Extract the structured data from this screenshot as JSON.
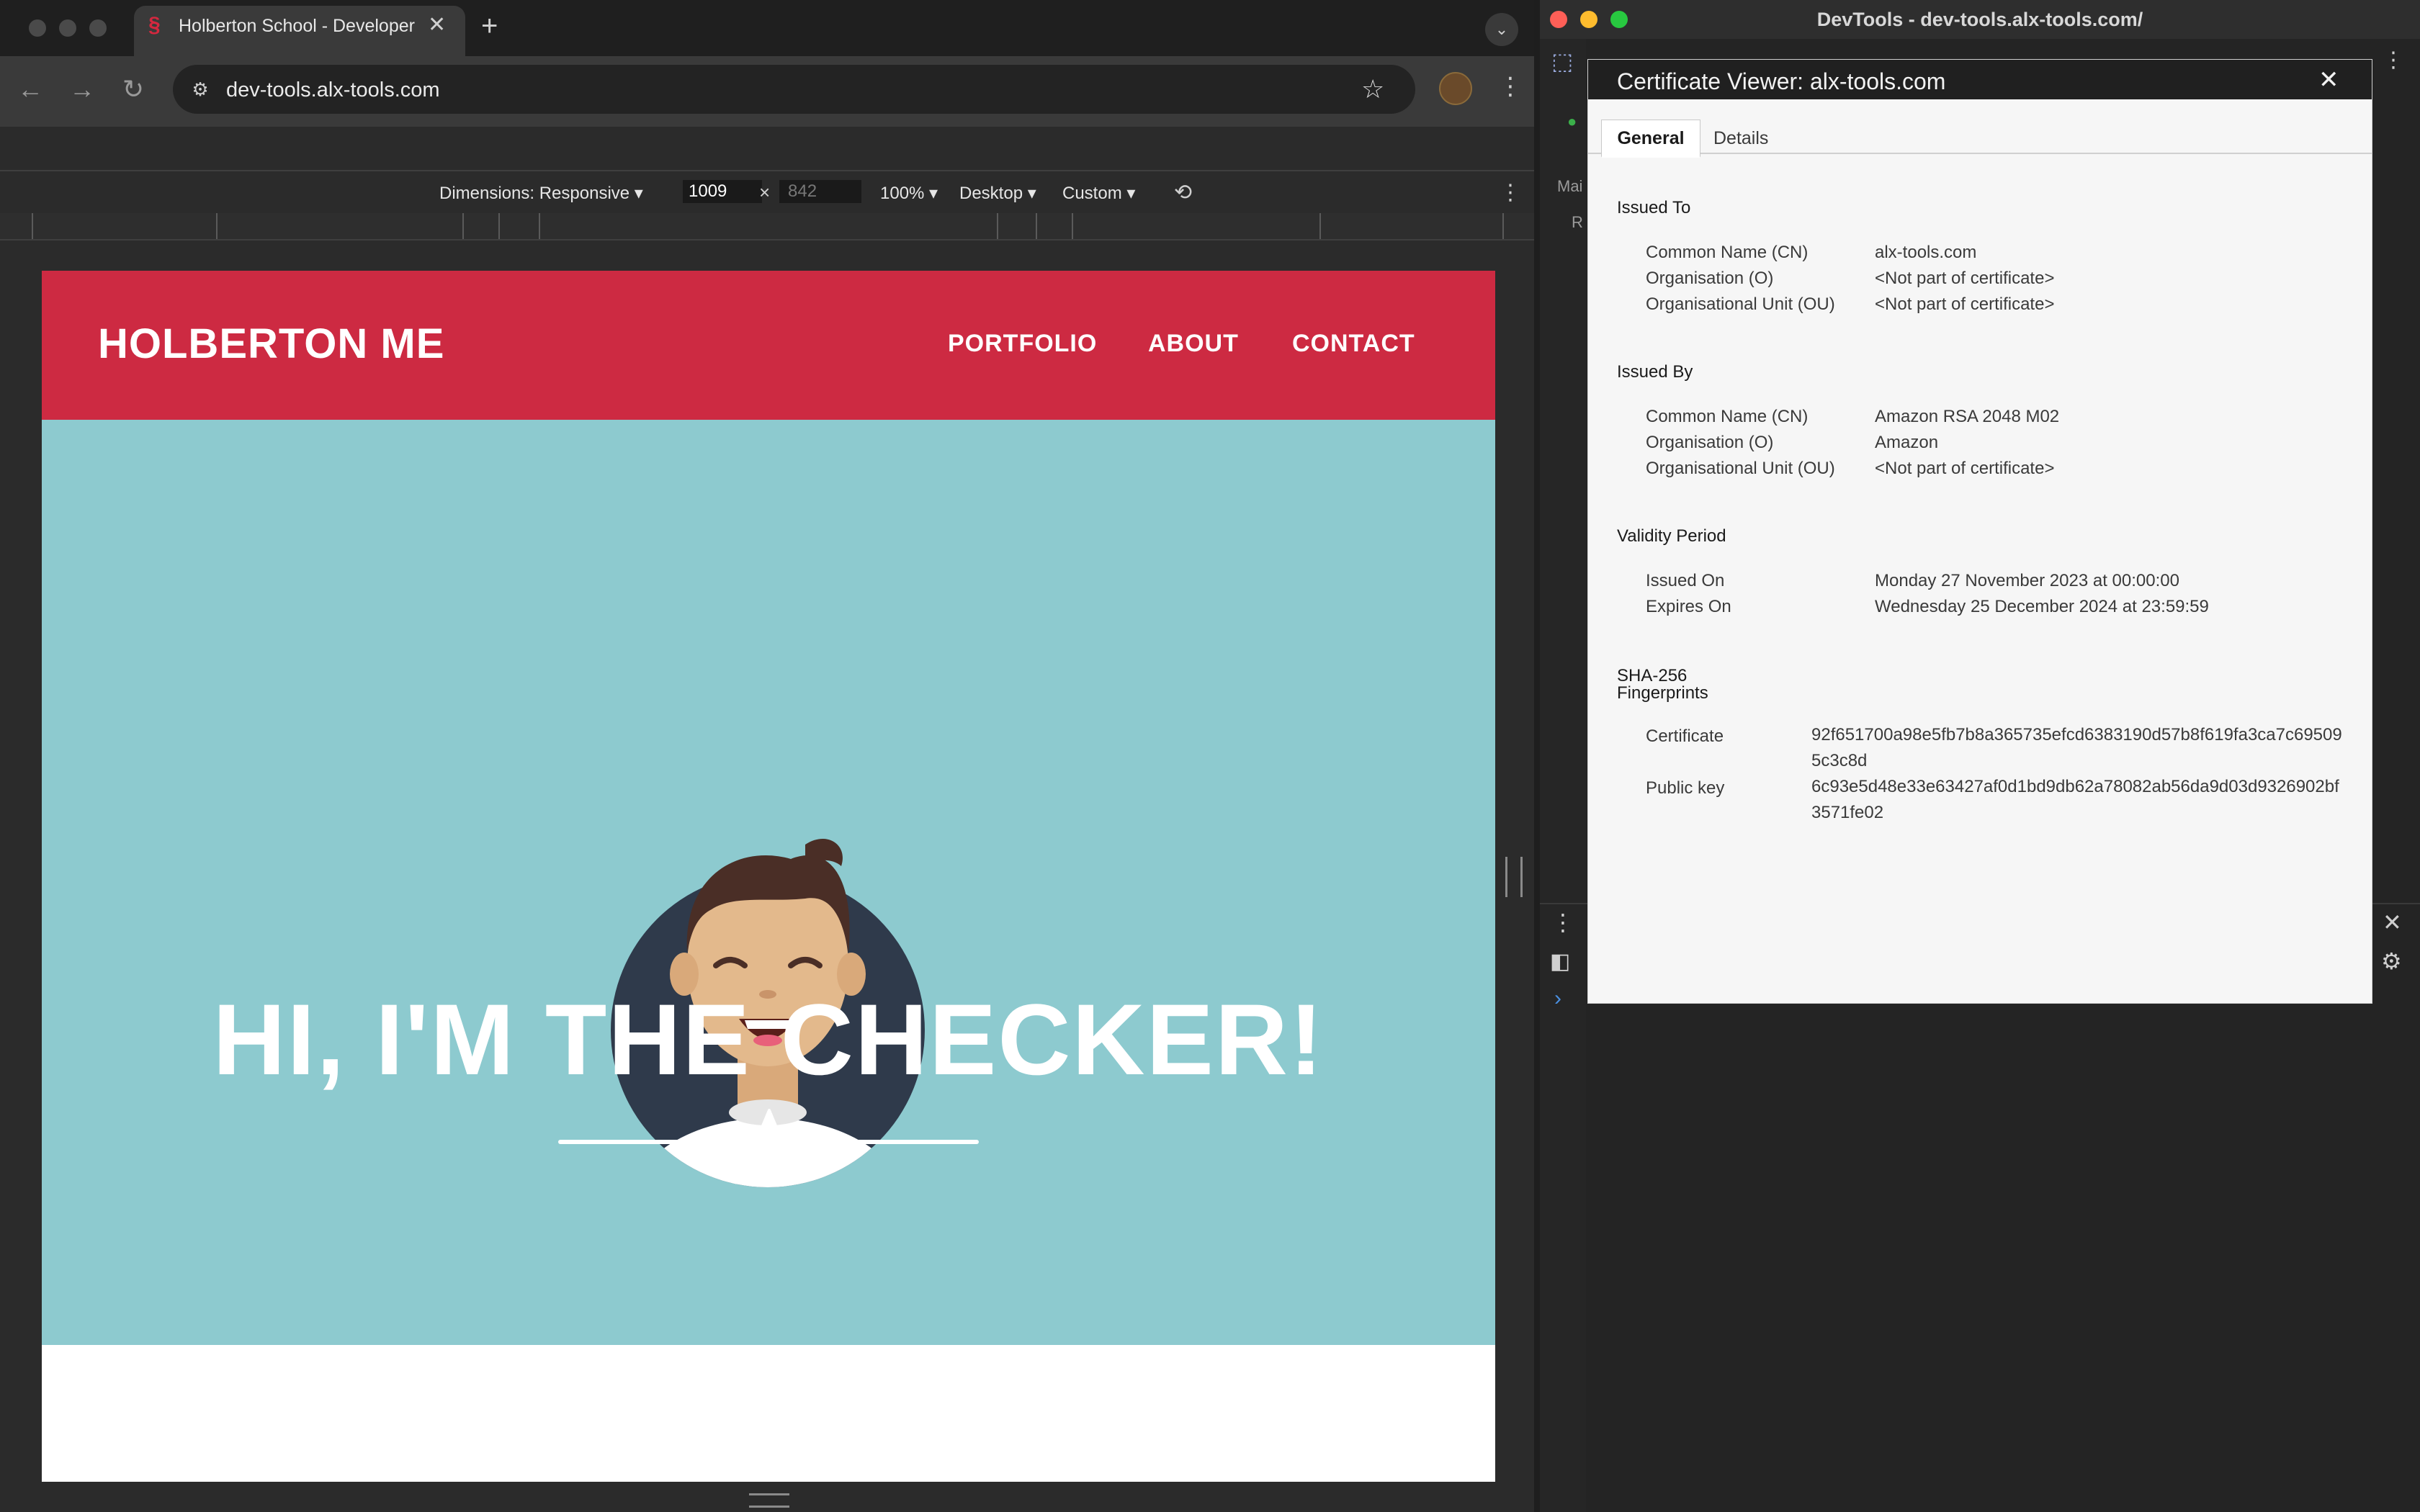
{
  "browser": {
    "tab_title": "Holberton School - Developer",
    "url": "dev-tools.alx-tools.com"
  },
  "device_toolbar": {
    "dimensions_label": "Dimensions: Responsive",
    "width": "1009",
    "height": "842",
    "zoom": "100%",
    "device_type": "Desktop",
    "throttle": "Custom"
  },
  "site": {
    "logo": "HOLBERTON ME",
    "nav": [
      "PORTFOLIO",
      "ABOUT",
      "CONTACT"
    ],
    "hero_title": "HI, I'M THE CHECKER!",
    "colors": {
      "header": "#cd2a42",
      "hero": "#8dcacf"
    }
  },
  "devtools": {
    "window_title": "DevTools - dev-tools.alx-tools.com/",
    "stub_1": "Mai",
    "stub_2": "R"
  },
  "certificate": {
    "title": "Certificate Viewer: alx-tools.com",
    "tabs": [
      "General",
      "Details"
    ],
    "issued_to": {
      "heading": "Issued To",
      "rows": [
        {
          "label": "Common Name (CN)",
          "value": "alx-tools.com"
        },
        {
          "label": "Organisation (O)",
          "value": "<Not part of certificate>"
        },
        {
          "label": "Organisational Unit (OU)",
          "value": "<Not part of certificate>"
        }
      ]
    },
    "issued_by": {
      "heading": "Issued By",
      "rows": [
        {
          "label": "Common Name (CN)",
          "value": "Amazon RSA 2048 M02"
        },
        {
          "label": "Organisation (O)",
          "value": "Amazon"
        },
        {
          "label": "Organisational Unit (OU)",
          "value": "<Not part of certificate>"
        }
      ]
    },
    "validity": {
      "heading": "Validity Period",
      "rows": [
        {
          "label": "Issued On",
          "value": "Monday 27 November 2023 at 00:00:00"
        },
        {
          "label": "Expires On",
          "value": "Wednesday 25 December 2024 at 23:59:59"
        }
      ]
    },
    "fingerprints": {
      "heading_1": "SHA-256",
      "heading_2": "Fingerprints",
      "rows": [
        {
          "label": "Certificate",
          "value": "92f651700a98e5fb7b8a365735efcd6383190d57b8f619fa3ca7c695095c3c8d"
        },
        {
          "label": "Public key",
          "value": "6c93e5d48e33e63427af0d1bd9db62a78082ab56da9d03d9326902bf3571fe02"
        }
      ]
    }
  }
}
